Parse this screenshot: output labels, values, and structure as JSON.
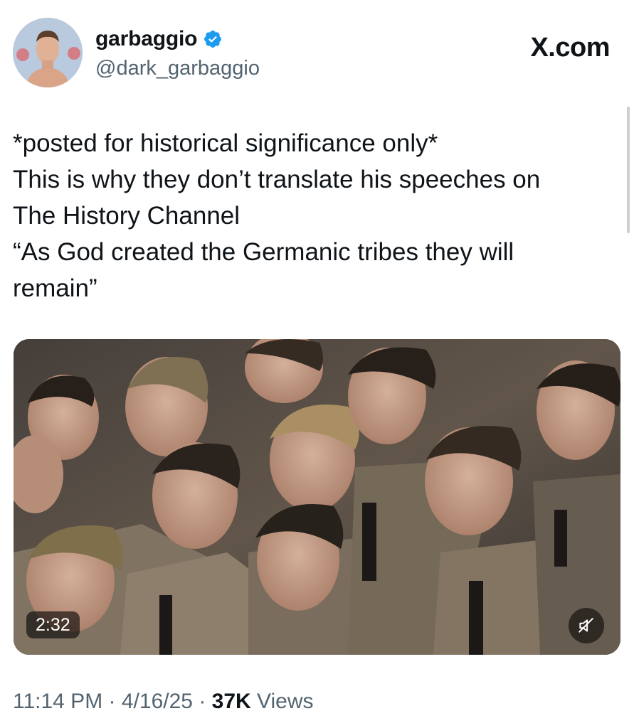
{
  "author": {
    "display_name": "garbaggio",
    "handle": "@dark_garbaggio",
    "verified_icon": "verified-badge-icon",
    "verified_color": "#1d9bf0"
  },
  "watermark": "X.com",
  "tweet": {
    "lines": [
      "*posted for historical significance only*",
      "This is why they don’t translate his speeches on",
      "The History Channel",
      "“As God created the Germanic tribes they will",
      "remain”"
    ]
  },
  "media": {
    "duration": "2:32",
    "mute_icon": "muted-speaker-icon"
  },
  "meta": {
    "time": "11:14 PM",
    "separator": "·",
    "date": "4/16/25",
    "views_count": "37K",
    "views_label": "Views"
  },
  "colors": {
    "text": "#0f1419",
    "secondary": "#536471",
    "accent": "#1d9bf0"
  }
}
